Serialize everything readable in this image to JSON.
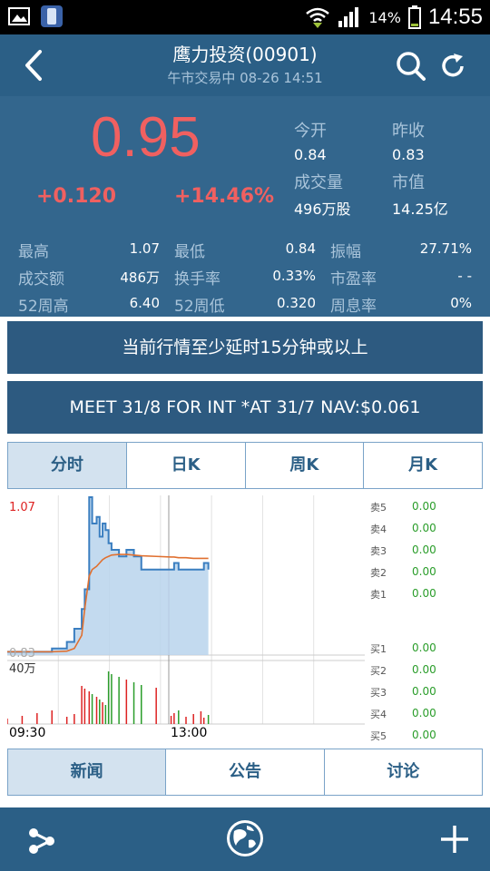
{
  "status_bar": {
    "battery_percent": "14%",
    "time": "14:55"
  },
  "header": {
    "title": "鹰力投资(00901)",
    "subtitle": "午市交易中  08-26  14:51"
  },
  "quote": {
    "price": "0.95",
    "change": "+0.120",
    "change_percent": "+14.46%",
    "open_label": "今开",
    "open_value": "0.84",
    "prev_close_label": "昨收",
    "prev_close_value": "0.83",
    "volume_label": "成交量",
    "volume_value": "496万股",
    "mktcap_label": "市值",
    "mktcap_value": "14.25亿"
  },
  "stats": [
    [
      {
        "label": "最高",
        "value": "1.07"
      },
      {
        "label": "最低",
        "value": "0.84"
      },
      {
        "label": "振幅",
        "value": "27.71%"
      }
    ],
    [
      {
        "label": "成交额",
        "value": "486万"
      },
      {
        "label": "换手率",
        "value": "0.33%"
      },
      {
        "label": "市盈率",
        "value": "- -"
      }
    ],
    [
      {
        "label": "52周高",
        "value": "6.40"
      },
      {
        "label": "52周低",
        "value": "0.320"
      },
      {
        "label": "周息率",
        "value": "0%"
      }
    ]
  ],
  "banners": {
    "delay_notice": "当前行情至少延时15分钟或以上",
    "news_ticker": "MEET 31/8 FOR INT  *AT 31/7 NAV:$0.061"
  },
  "chart_tabs": [
    "分时",
    "日K",
    "周K",
    "月K"
  ],
  "chart_tab_active": 0,
  "chart_data": {
    "type": "line",
    "y_top_label": "1.07",
    "y_bottom_label": "0.83",
    "volume_label": "40万",
    "x_tick_labels": [
      "09:30",
      "13:00"
    ],
    "x": [
      0,
      10,
      20,
      30,
      40,
      45,
      50,
      52,
      55,
      57,
      60,
      62,
      64,
      66,
      68,
      70,
      75,
      80,
      85,
      90,
      100,
      110,
      112,
      115,
      120,
      125,
      130,
      132,
      135
    ],
    "series": [
      {
        "values": [
          0.835,
          0.835,
          0.835,
          0.84,
          0.85,
          0.87,
          0.9,
          0.93,
          1.07,
          1.03,
          1.04,
          1.01,
          1.03,
          1.02,
          1.0,
          0.99,
          0.98,
          0.99,
          0.98,
          0.96,
          0.96,
          0.96,
          0.97,
          0.96,
          0.96,
          0.96,
          0.96,
          0.97,
          0.96
        ]
      },
      {
        "values": [
          0.835,
          0.835,
          0.835,
          0.835,
          0.836,
          0.84,
          0.86,
          0.9,
          0.95,
          0.96,
          0.965,
          0.97,
          0.975,
          0.978,
          0.98,
          0.982,
          0.983,
          0.983,
          0.982,
          0.981,
          0.98,
          0.979,
          0.979,
          0.978,
          0.978,
          0.977,
          0.977,
          0.977,
          0.977
        ]
      }
    ],
    "ylim": [
      0.83,
      1.07
    ],
    "xlim": [
      0,
      240
    ]
  },
  "order_book": [
    {
      "label": "卖5",
      "value": "0.00"
    },
    {
      "label": "卖4",
      "value": "0.00"
    },
    {
      "label": "卖3",
      "value": "0.00"
    },
    {
      "label": "卖2",
      "value": "0.00"
    },
    {
      "label": "卖1",
      "value": "0.00"
    },
    {
      "label": "买1",
      "value": "0.00"
    },
    {
      "label": "买2",
      "value": "0.00"
    },
    {
      "label": "买3",
      "value": "0.00"
    },
    {
      "label": "买4",
      "value": "0.00"
    },
    {
      "label": "买5",
      "value": "0.00"
    }
  ],
  "bottom_tabs": [
    "新闻",
    "公告",
    "讨论"
  ],
  "bottom_tab_active": 0,
  "colors": {
    "header_bg": "#2b5f86",
    "panel_bg": "#33668d",
    "price_red": "#f06060",
    "avg_line": "#e07030",
    "price_line": "#3a7ec0",
    "fill": "#b9d3ec",
    "green": "#2a9d2a"
  },
  "icons": {
    "status_left": [
      "image-icon",
      "phone-icon"
    ],
    "status_right": [
      "wifi-icon",
      "signal-icon",
      "battery-icon"
    ],
    "header": [
      "back-icon",
      "search-icon",
      "refresh-icon"
    ],
    "footer": [
      "share-icon",
      "globe-icon",
      "plus-icon"
    ]
  }
}
